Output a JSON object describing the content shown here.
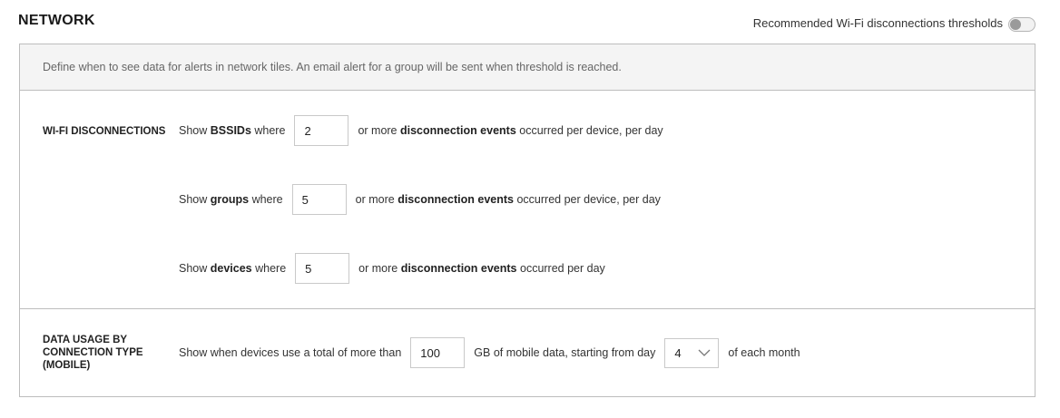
{
  "header": {
    "title": "NETWORK",
    "toggle_label": "Recommended Wi-Fi disconnections thresholds",
    "toggle_on": false
  },
  "info": "Define when to see data for alerts in network tiles. An email alert for a group will be sent when threshold is reached.",
  "wifi": {
    "label": "WI-FI DISCONNECTIONS",
    "rows": [
      {
        "pre": "Show ",
        "pre_bold": "BSSIDs",
        "mid": " where",
        "value": "2",
        "post": "or more ",
        "post_bold": "disconnection events",
        "post_end": " occurred per device, per day"
      },
      {
        "pre": "Show ",
        "pre_bold": "groups",
        "mid": " where",
        "value": "5",
        "post": "or more ",
        "post_bold": "disconnection events",
        "post_end": " occurred per device, per day"
      },
      {
        "pre": "Show ",
        "pre_bold": "devices",
        "mid": " where",
        "value": "5",
        "post": "or more ",
        "post_bold": "disconnection events",
        "post_end": " occurred per day"
      }
    ]
  },
  "data_usage": {
    "label_line1": "DATA USAGE BY",
    "label_line2": "CONNECTION TYPE",
    "label_line3": "(MOBILE)",
    "pre": "Show when devices use a total of more than",
    "value": "100",
    "mid": "GB of mobile data, starting from day",
    "day": "4",
    "post": "of each month"
  },
  "icons": {
    "toggle": "toggle-switch",
    "dropdown": "chevron-down-icon"
  }
}
